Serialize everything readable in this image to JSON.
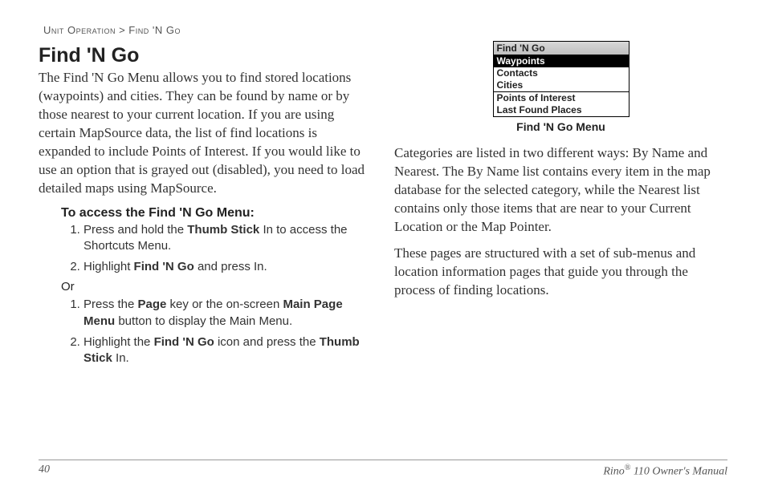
{
  "breadcrumb": {
    "section": "Unit Operation",
    "sep": ">",
    "page": "Find 'N Go"
  },
  "title": "Find 'N Go",
  "intro": "The Find 'N Go Menu allows you to find stored locations (waypoints) and cities. They can be found by name or by those nearest to your current location. If you are using certain MapSource data, the list of find locations is expanded to include Points of Interest. If you would like to use an option that is grayed out (disabled), you need to load detailed maps using MapSource.",
  "instructions": {
    "heading": "To access the Find 'N Go Menu:",
    "setA": [
      {
        "pre": "Press and hold the ",
        "b1": "Thumb Stick",
        "post": " In to access the Shortcuts Menu."
      },
      {
        "pre": "Highlight ",
        "b1": "Find 'N Go",
        "post": " and press In."
      }
    ],
    "or": "Or",
    "setB": [
      {
        "pre": "Press the ",
        "b1": "Page",
        "mid": " key or the on-screen ",
        "b2": "Main Page Menu",
        "post": " button to display the Main Menu."
      },
      {
        "pre": "Highlight the ",
        "b1": "Find 'N Go",
        "mid": " icon and press the ",
        "b2": "Thumb Stick",
        "post": " In."
      }
    ]
  },
  "figure": {
    "title": "Find 'N Go",
    "items": [
      "Waypoints",
      "Contacts",
      "Cities"
    ],
    "items2": [
      "Points of Interest",
      "Last Found Places"
    ],
    "caption": "Find 'N Go Menu"
  },
  "para2": "Categories are listed in two different ways: By Name and Nearest. The By Name list contains every item in the map database for the selected category, while the Nearest list contains only those items that are near to your Current Location or the Map Pointer.",
  "para3": "These pages are structured with a set of sub-menus and location information pages that guide you through the process of finding locations.",
  "footer": {
    "pageNumber": "40",
    "product": "Rino",
    "model": " 110 Owner's Manual",
    "reg": "®"
  }
}
